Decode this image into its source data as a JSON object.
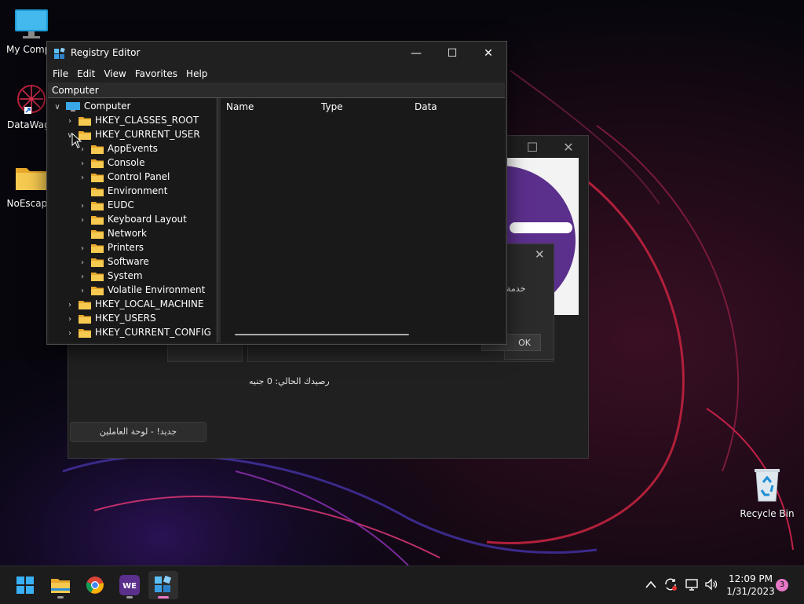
{
  "desktop": {
    "icons": [
      {
        "label": "My Compu",
        "icon": "monitor-icon"
      },
      {
        "label": "DataWago",
        "icon": "datawagon-icon"
      },
      {
        "label": "NoEscape.",
        "icon": "folder-icon"
      }
    ],
    "recycle_bin": {
      "label": "Recycle Bin",
      "icon": "recycle-bin-icon"
    }
  },
  "background_app": {
    "balance_text": "رصيدك الحالي: 0 جنيه",
    "staff_button": "جديد! - لوحة العاملين",
    "maximize_glyph": "☐",
    "close_glyph": "✕"
  },
  "dialog": {
    "text": "خدمة",
    "ok_label": "OK",
    "close_glyph": "✕"
  },
  "regedit": {
    "title": "Registry Editor",
    "minimize_glyph": "—",
    "maximize_glyph": "☐",
    "close_glyph": "✕",
    "menu": [
      "File",
      "Edit",
      "View",
      "Favorites",
      "Help"
    ],
    "address": "Computer",
    "tree": {
      "root": "Computer",
      "hkcr": "HKEY_CLASSES_ROOT",
      "hkcu": "HKEY_CURRENT_USER",
      "hkcu_children": [
        {
          "label": "AppEvents",
          "has_children": true
        },
        {
          "label": "Console",
          "has_children": true
        },
        {
          "label": "Control Panel",
          "has_children": true
        },
        {
          "label": "Environment",
          "has_children": false
        },
        {
          "label": "EUDC",
          "has_children": true
        },
        {
          "label": "Keyboard Layout",
          "has_children": true
        },
        {
          "label": "Network",
          "has_children": false
        },
        {
          "label": "Printers",
          "has_children": true
        },
        {
          "label": "Software",
          "has_children": true
        },
        {
          "label": "System",
          "has_children": true
        },
        {
          "label": "Volatile Environment",
          "has_children": true
        }
      ],
      "hklm": "HKEY_LOCAL_MACHINE",
      "hku": "HKEY_USERS",
      "hkcc": "HKEY_CURRENT_CONFIG"
    },
    "columns": {
      "name": "Name",
      "type": "Type",
      "data": "Data"
    }
  },
  "taskbar": {
    "items": [
      "start-icon",
      "file-explorer-icon",
      "chrome-icon",
      "we-app-icon",
      "regedit-icon"
    ],
    "clock_time": "12:09 PM",
    "clock_date": "1/31/2023",
    "notification_count": "3"
  },
  "colors": {
    "folder": "#f4c44e",
    "accent_pink": "#e879c8",
    "brand_purple": "#5b2f8c"
  }
}
